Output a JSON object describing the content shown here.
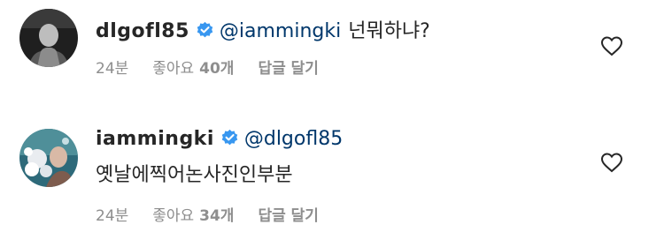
{
  "comments": [
    {
      "username": "dlgofl85",
      "mention": "@iammingki",
      "text": "넌뭐하냐?",
      "time": "24분",
      "likes_label": "좋아요",
      "likes_count": "40개",
      "reply_label": "답글 달기",
      "verified": true
    },
    {
      "username": "iammingki",
      "mention": "@dlgofl85",
      "text": "옛날에찍어논사진인부분",
      "time": "24분",
      "likes_label": "좋아요",
      "likes_count": "34개",
      "reply_label": "답글 달기",
      "verified": true
    }
  ],
  "colors": {
    "mention": "#00376b",
    "verified": "#3897f0",
    "meta": "#8e8e8e"
  }
}
